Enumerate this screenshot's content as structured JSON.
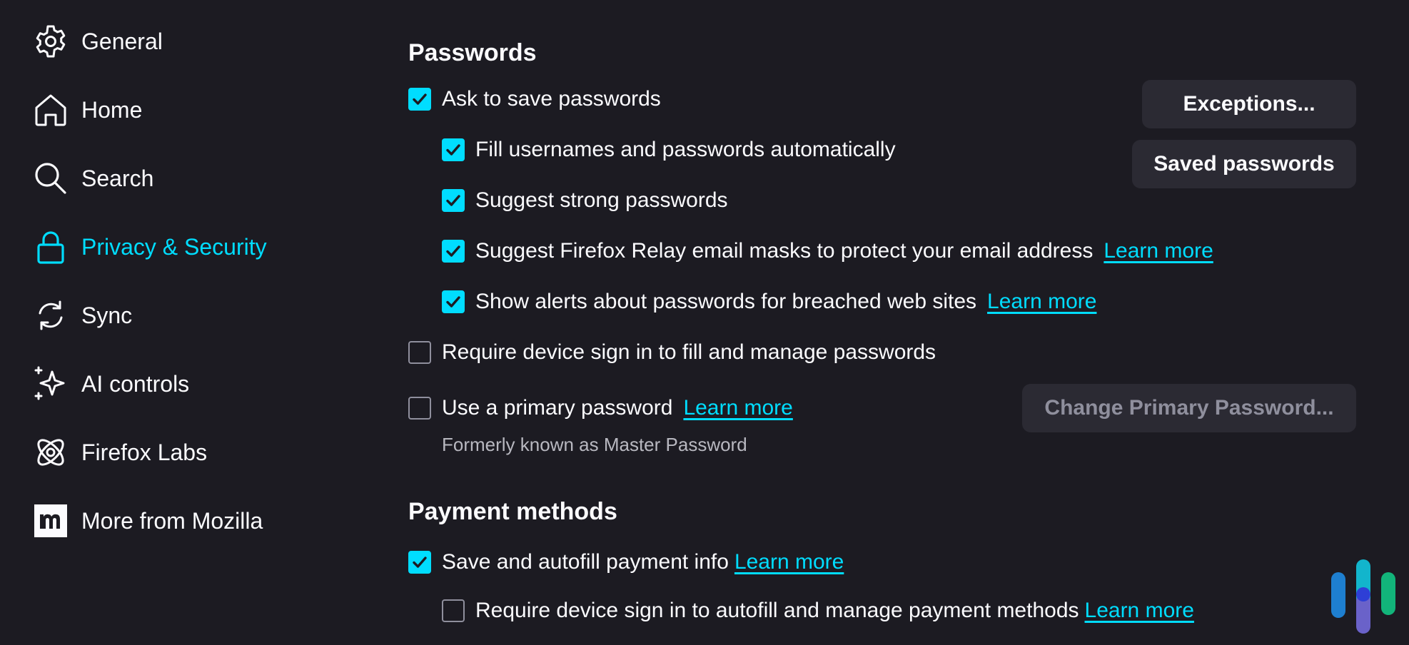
{
  "sidebar": {
    "items": [
      {
        "label": "General",
        "icon": "gear-icon"
      },
      {
        "label": "Home",
        "icon": "home-icon"
      },
      {
        "label": "Search",
        "icon": "search-icon"
      },
      {
        "label": "Privacy & Security",
        "icon": "lock-icon",
        "active": true
      },
      {
        "label": "Sync",
        "icon": "sync-icon"
      },
      {
        "label": "AI controls",
        "icon": "sparkle-icon"
      },
      {
        "label": "Firefox Labs",
        "icon": "atom-icon"
      },
      {
        "label": "More from Mozilla",
        "icon": "mozilla-icon"
      }
    ]
  },
  "passwords": {
    "title": "Passwords",
    "ask_to_save": {
      "label": "Ask to save passwords",
      "checked": true
    },
    "fill_auto": {
      "label": "Fill usernames and passwords automatically",
      "checked": true
    },
    "suggest_strong": {
      "label": "Suggest strong passwords",
      "checked": true
    },
    "relay": {
      "label": "Suggest Firefox Relay email masks to protect your email address",
      "checked": true,
      "link": "Learn more"
    },
    "breach_alerts": {
      "label": "Show alerts about passwords for breached web sites",
      "checked": true,
      "link": "Learn more"
    },
    "require_signin": {
      "label": "Require device sign in to fill and manage passwords",
      "checked": false
    },
    "primary_password": {
      "label": "Use a primary password",
      "checked": false,
      "link": "Learn more",
      "helper": "Formerly known as Master Password"
    },
    "buttons": {
      "exceptions": "Exceptions...",
      "saved_passwords": "Saved passwords",
      "change_primary": "Change Primary Password..."
    }
  },
  "payment": {
    "title": "Payment methods",
    "save_autofill": {
      "label": "Save and autofill payment info",
      "checked": true,
      "link": "Learn more"
    },
    "require_signin": {
      "label": "Require device sign in to autofill and manage payment methods",
      "checked": false,
      "link": "Learn more"
    }
  },
  "colors": {
    "background": "#1c1b22",
    "accent": "#00ddff",
    "text": "#fbfbfe",
    "button_bg": "#2b2a33"
  }
}
